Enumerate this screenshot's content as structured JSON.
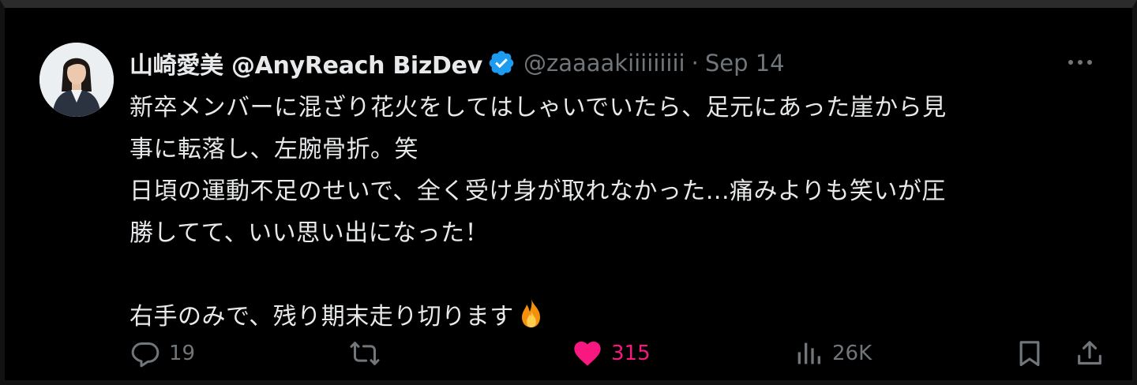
{
  "tweet": {
    "author": {
      "display_name": "山崎愛美 @AnyReach BizDev",
      "handle": "@zaaaakiiiiiiiii",
      "verified": true,
      "avatar": "avatar-photo"
    },
    "separator": "·",
    "time": "Sep 14",
    "body_lines": [
      "新卒メンバーに混ざり花火をしてはしゃいでいたら、足元にあった崖から見",
      "事に転落し、左腕骨折。笑",
      "日頃の運動不足のせいで、全く受け身が取れなかった...痛みよりも笑いが圧",
      "勝してて、いい思い出になった！",
      "",
      "右手のみで、残り期末走り切ります"
    ],
    "emoji": "fire",
    "stats": {
      "replies": "19",
      "reposts": "",
      "likes": "315",
      "views": "26K"
    }
  },
  "icons": {
    "more": "more-horizontal-icon",
    "reply": "reply-icon",
    "repost": "repost-icon",
    "like": "heart-filled-icon",
    "views": "views-icon",
    "bookmark": "bookmark-icon",
    "share": "share-icon"
  },
  "colors": {
    "background": "#000000",
    "text": "#e7e9ea",
    "muted": "#71767b",
    "verified": "#1d9bf0",
    "like": "#f91880"
  }
}
